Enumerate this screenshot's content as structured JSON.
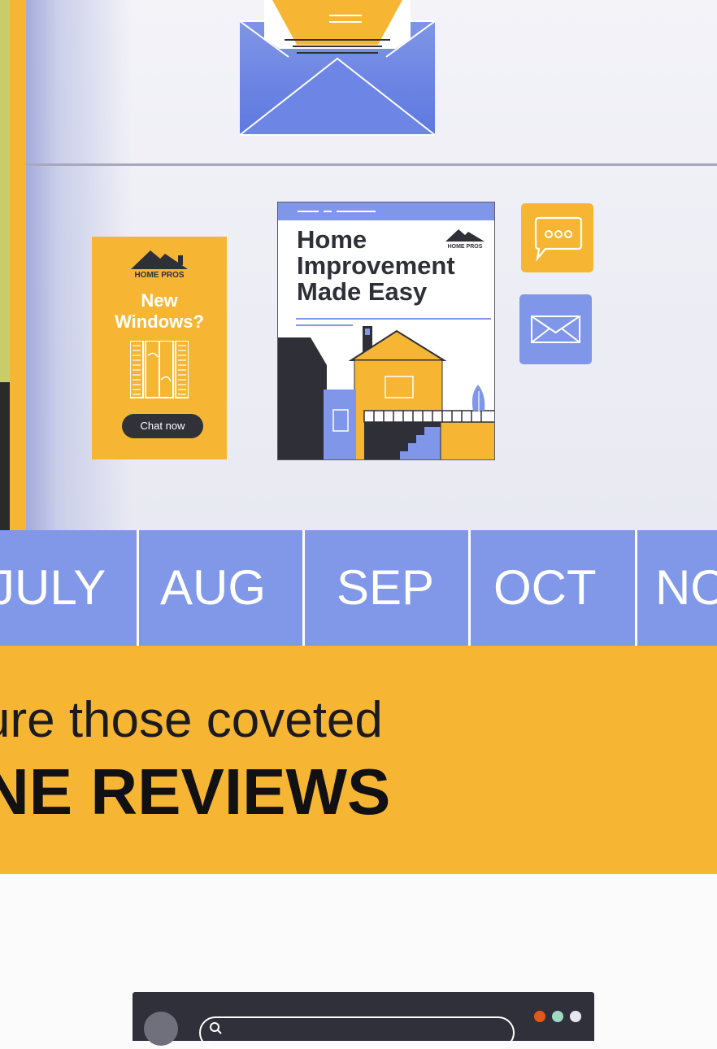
{
  "ad_windows": {
    "logo_text": "HOME PROS",
    "headline_line1": "New",
    "headline_line2": "Windows?",
    "cta": "Chat now"
  },
  "ad_home": {
    "logo_text": "HOME PROS",
    "title_line1": "Home",
    "title_line2": "Improvement",
    "title_line3": "Made Easy"
  },
  "timeline": {
    "months": [
      "JULY",
      "AUG",
      "SEP",
      "OCT",
      "NO"
    ]
  },
  "banner": {
    "line1": "ure those coveted",
    "line2": "NE REVIEWS"
  },
  "colors": {
    "yellow": "#f6b634",
    "periwinkle": "#8197e8",
    "dark": "#2f3039"
  },
  "browser_dots": [
    "#e4571b",
    "#9fd9c3",
    "#e6e6ee"
  ]
}
